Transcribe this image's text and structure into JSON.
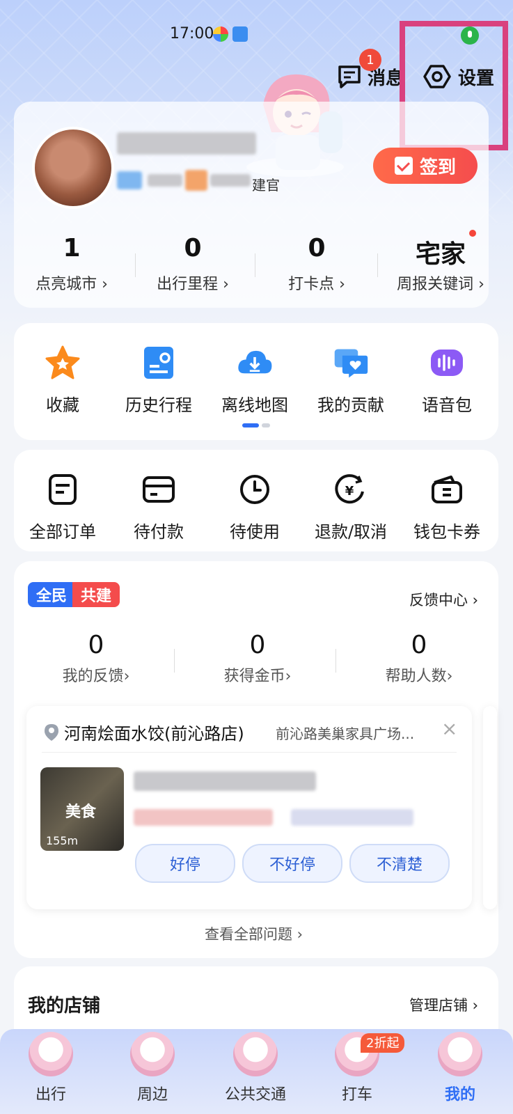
{
  "status_bar": {
    "time": "17:00"
  },
  "header": {
    "message_label": "消息",
    "message_badge": "1",
    "settings_label": "设置",
    "role_text": "建官",
    "checkin_label": "签到"
  },
  "profile_stats": [
    {
      "value": "1",
      "label": "点亮城市"
    },
    {
      "value": "0",
      "label": "出行里程"
    },
    {
      "value": "0",
      "label": "打卡点"
    },
    {
      "value": "宅家",
      "label": "周报关键词"
    }
  ],
  "shortcuts": [
    {
      "label": "收藏",
      "icon": "star-icon"
    },
    {
      "label": "历史行程",
      "icon": "history-route-icon"
    },
    {
      "label": "离线地图",
      "icon": "download-cloud-icon"
    },
    {
      "label": "我的贡献",
      "icon": "contribution-chat-icon"
    },
    {
      "label": "语音包",
      "icon": "voice-wave-icon"
    }
  ],
  "orders": [
    {
      "label": "全部订单",
      "icon": "order-list-icon"
    },
    {
      "label": "待付款",
      "icon": "card-icon"
    },
    {
      "label": "待使用",
      "icon": "clock-icon"
    },
    {
      "label": "退款/取消",
      "icon": "refund-icon"
    },
    {
      "label": "钱包卡券",
      "icon": "wallet-icon"
    }
  ],
  "feedback": {
    "tag_left": "全民",
    "tag_right": "共建",
    "center_link": "反馈中心",
    "stats": [
      {
        "value": "0",
        "label": "我的反馈"
      },
      {
        "value": "0",
        "label": "获得金币"
      },
      {
        "value": "0",
        "label": "帮助人数"
      }
    ],
    "place_name": "河南烩面水饺(前沁路店)",
    "place_address": "前沁路美巢家具广场...",
    "thumb_tag": "美食",
    "thumb_distance": "155m",
    "options": [
      "好停",
      "不好停",
      "不清楚"
    ],
    "view_all": "查看全部问题"
  },
  "shop": {
    "title": "我的店铺",
    "manage_link": "管理店铺"
  },
  "tabbar": {
    "promo_badge": "2折起",
    "items": [
      "出行",
      "周边",
      "公共交通",
      "打车",
      "我的"
    ]
  },
  "colors": {
    "accent": "#2f6ef5",
    "highlight_box": "#d9417e",
    "checkin": "#f54d4d"
  }
}
